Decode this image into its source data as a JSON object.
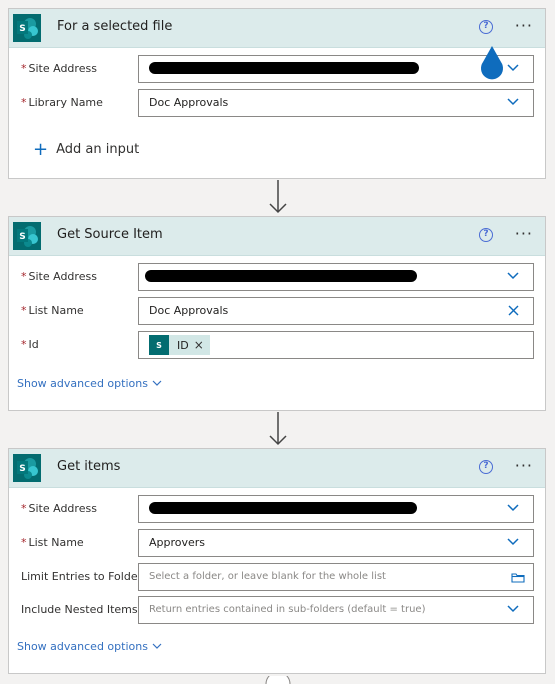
{
  "cards": [
    {
      "title": "For a selected file",
      "fields": [
        {
          "label": "Site Address",
          "required": true,
          "value": ""
        },
        {
          "label": "Library Name",
          "required": true,
          "value": "Doc Approvals"
        }
      ],
      "add_input_label": "Add an input"
    },
    {
      "title": "Get Source Item",
      "fields": [
        {
          "label": "Site Address",
          "required": true,
          "value": ""
        },
        {
          "label": "List Name",
          "required": true,
          "value": "Doc Approvals"
        },
        {
          "label": "Id",
          "required": true,
          "token": "ID"
        }
      ],
      "advanced_label": "Show advanced options"
    },
    {
      "title": "Get items",
      "fields": [
        {
          "label": "Site Address",
          "required": true,
          "value": ""
        },
        {
          "label": "List Name",
          "required": true,
          "value": "Approvers"
        },
        {
          "label": "Limit Entries to Folder",
          "required": false,
          "placeholder": "Select a folder, or leave blank for the whole list"
        },
        {
          "label": "Include Nested Items",
          "required": false,
          "placeholder": "Return entries contained in sub-folders (default = true)"
        }
      ],
      "advanced_label": "Show advanced options"
    }
  ],
  "icons": {
    "help": "help-circle-icon",
    "more": "more-options-icon",
    "logo": "sharepoint-logo-icon",
    "chevron": "chevron-down-icon",
    "clear": "clear-icon",
    "folder": "folder-icon",
    "arrow": "arrow-down-icon"
  },
  "colors": {
    "header_bg": "#dcebeb",
    "accent_blue": "#0f6cbd",
    "link_blue": "#3470c0",
    "sharepoint_teal": "#036c70",
    "required_red": "#a4262c"
  }
}
